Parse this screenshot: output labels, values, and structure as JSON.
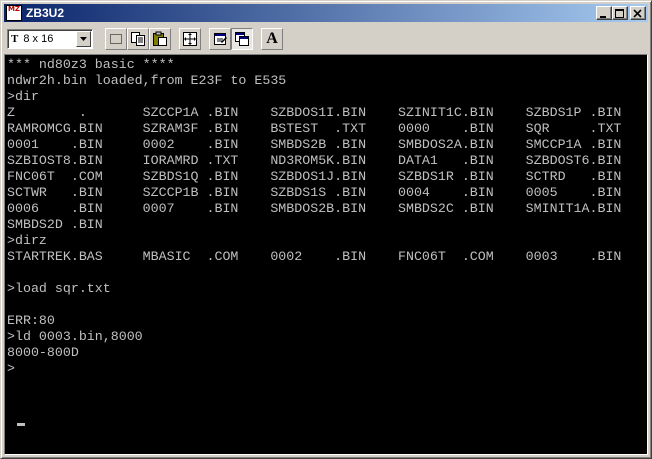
{
  "window": {
    "title": "ZB3U2",
    "icon_label": "MZ"
  },
  "toolbar": {
    "font_icon_label": "T",
    "font_size_value": "8 x 16",
    "buttons": [
      "mark-icon",
      "copy-icon",
      "paste-icon",
      "fullscreen-icon",
      "properties-icon",
      "background-icon",
      "font-icon"
    ],
    "font_button_label": "A"
  },
  "console": {
    "text": "*** nd80z3 basic ****\nndwr2h.bin loaded,from E23F to E535\n>dir\nZ        .       SZCCP1A .BIN    SZBDOS1I.BIN    SZINIT1C.BIN    SZBDS1P .BIN\nRAMROMCG.BIN     SZRAM3F .BIN    BSTEST  .TXT    0000    .BIN    SQR     .TXT\n0001    .BIN     0002    .BIN    SMBDS2B .BIN    SMBDOS2A.BIN    SMCCP1A .BIN\nSZBIOST8.BIN     IORAMRD .TXT    ND3ROM5K.BIN    DATA1   .BIN    SZBDOST6.BIN\nFNC06T  .COM     SZBDS1Q .BIN    SZBDOS1J.BIN    SZBDS1R .BIN    SCTRD   .BIN\nSCTWR   .BIN     SZCCP1B .BIN    SZBDS1S .BIN    0004    .BIN    0005    .BIN\n0006    .BIN     0007    .BIN    SMBDOS2B.BIN    SMBDS2C .BIN    SMINIT1A.BIN\nSMBDS2D .BIN\n>dirz\nSTARTREK.BAS     MBASIC  .COM    0002    .BIN    FNC06T  .COM    0003    .BIN\n\n>load sqr.txt\n\nERR:80\n>ld 0003.bin,8000\n8000-800D\n>",
    "cursor": "_"
  },
  "colors": {
    "title_bar_start": "#0a246a",
    "title_bar_end": "#a6caf0",
    "console_bg": "#000000",
    "console_fg": "#c0c0c0",
    "chrome": "#d4d0c8"
  }
}
